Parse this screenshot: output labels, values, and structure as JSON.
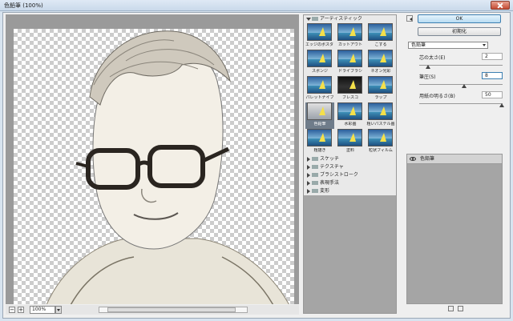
{
  "window": {
    "title": "色鉛筆 (100%)"
  },
  "preview": {
    "zoom_value": "100%"
  },
  "gallery": {
    "open_category": "アーティスティック",
    "thumbnails": [
      {
        "label": "エッジのポスタリゼーション"
      },
      {
        "label": "カットアウト"
      },
      {
        "label": "こする"
      },
      {
        "label": "スポンジ"
      },
      {
        "label": "ドライブラシ"
      },
      {
        "label": "ネオン光彩"
      },
      {
        "label": "パレットナイフ"
      },
      {
        "label": "フレスコ"
      },
      {
        "label": "ラップ"
      },
      {
        "label": "色鉛筆",
        "selected": true
      },
      {
        "label": "水彩画"
      },
      {
        "label": "粗いパステル画"
      },
      {
        "label": "粗描き"
      },
      {
        "label": "塗料"
      },
      {
        "label": "粒状フィルム"
      }
    ],
    "collapsed_categories": [
      "スケッチ",
      "テクスチャ",
      "ブラシストローク",
      "表現手法",
      "変形"
    ]
  },
  "buttons": {
    "ok_label": "OK",
    "reset_label": "初期化"
  },
  "filter_select": {
    "value": "色鉛筆"
  },
  "params": [
    {
      "label": "芯の太さ(E)",
      "value": "2",
      "level": 0.08
    },
    {
      "label": "筆圧(S)",
      "value": "8",
      "level": 0.53
    },
    {
      "label": "用紙の明るさ(B)",
      "value": "50",
      "level": 1.0
    }
  ],
  "layers": [
    {
      "name": "色鉛筆"
    }
  ],
  "colors": {
    "accent": "#3c7fb1",
    "panel": "#efefef"
  }
}
